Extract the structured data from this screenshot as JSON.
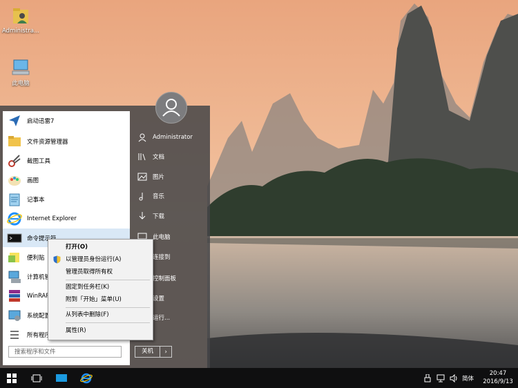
{
  "desktop": {
    "icons": [
      {
        "label": "Administra...",
        "icon": "user-folder-icon"
      },
      {
        "label": "此电脑",
        "icon": "computer-icon"
      }
    ]
  },
  "start_menu": {
    "programs": [
      {
        "label": "启动迅雷7",
        "icon": "thunder-icon"
      },
      {
        "label": "文件资源管理器",
        "icon": "folder-icon"
      },
      {
        "label": "截图工具",
        "icon": "snipping-tool-icon"
      },
      {
        "label": "画图",
        "icon": "paint-icon"
      },
      {
        "label": "记事本",
        "icon": "notepad-icon"
      },
      {
        "label": "Internet Explorer",
        "icon": "ie-icon"
      },
      {
        "label": "命令提示符",
        "icon": "cmd-icon"
      },
      {
        "label": "便利贴",
        "icon": "sticky-notes-icon"
      },
      {
        "label": "计算机管",
        "icon": "computer-management-icon"
      },
      {
        "label": "WinRAR",
        "icon": "winrar-icon"
      },
      {
        "label": "系统配置",
        "icon": "system-config-icon"
      },
      {
        "label": "所有程序",
        "icon": "all-programs-icon"
      }
    ],
    "search_placeholder": "搜索程序和文件",
    "places": [
      {
        "label": "Administrator",
        "icon": "user-icon"
      },
      {
        "label": "文档",
        "icon": "documents-icon"
      },
      {
        "label": "图片",
        "icon": "pictures-icon"
      },
      {
        "label": "音乐",
        "icon": "music-icon"
      },
      {
        "label": "下载",
        "icon": "downloads-icon"
      },
      {
        "label": "此电脑",
        "icon": "computer-icon"
      },
      {
        "label": "连接到",
        "icon": "connect-icon"
      },
      {
        "label": "控制面板",
        "icon": "control-panel-icon"
      },
      {
        "label": "设置",
        "icon": "settings-icon"
      },
      {
        "label": "运行...",
        "icon": "run-icon"
      }
    ],
    "shutdown_label": "关机",
    "shutdown_arrow": "›"
  },
  "context_menu": {
    "items": [
      {
        "label": "打开(O)"
      },
      {
        "label": "以管理员身份运行(A)",
        "icon": "uac-shield-icon"
      },
      {
        "label": "管理员取得所有权"
      },
      {
        "label": "固定到任务栏(K)"
      },
      {
        "label": "附到「开始」菜单(U)"
      },
      {
        "label": "从列表中删除(F)"
      },
      {
        "label": "属性(R)"
      }
    ]
  },
  "taskbar": {
    "buttons": [
      {
        "icon": "windows-start-icon"
      },
      {
        "icon": "task-view-icon"
      },
      {
        "icon": "desktop-icon"
      },
      {
        "icon": "ie-icon"
      }
    ],
    "ime_label": "简体",
    "time": "20:47",
    "date": "2016/9/13"
  },
  "colors": {
    "selection": "#d9e8f6",
    "ie_blue": "#1e90ff",
    "taskbar": "#0f0f10"
  }
}
